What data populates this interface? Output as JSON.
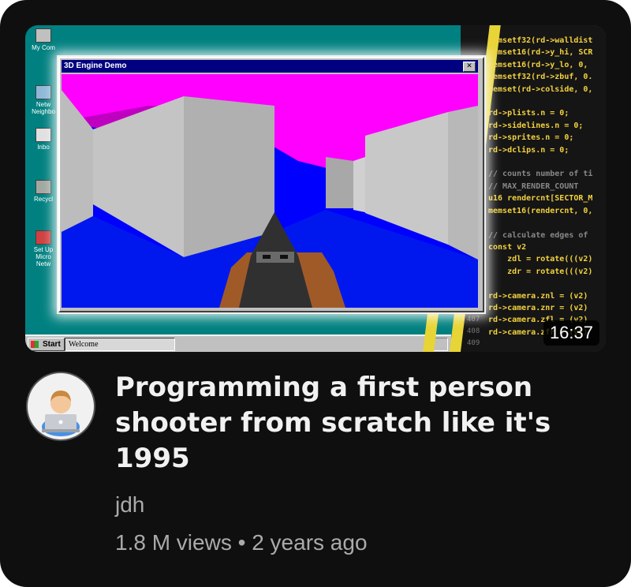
{
  "video": {
    "title": "Programming a first person shooter from scratch like it's 1995",
    "channel": "jdh",
    "views": "1.8 M views",
    "separator": "•",
    "age": "2 years ago",
    "duration": "16:37",
    "avatar_icon": "technologist-with-laptop-icon"
  },
  "thumbnail": {
    "window_title": "3D Engine Demo",
    "close_glyph": "✕",
    "desktop_icons": [
      "My Com",
      "Netw Neighbo",
      "Inbo",
      "Recycl",
      "Set Up Micro Netw"
    ],
    "taskbar": {
      "start_label": "Start",
      "task_label": "Welcome"
    },
    "code_lines": [
      "memsetf32(rd->walldist",
      "memset16(rd->y_hi, SCR",
      "memset16(rd->y_lo, 0,",
      "memsetf32(rd->zbuf, 0.",
      "memset(rd->colside, 0,",
      "",
      "rd->plists.n = 0;",
      "rd->sidelines.n = 0;",
      "rd->sprites.n = 0;",
      "rd->dclips.n = 0;",
      "",
      "// counts number of ti",
      "// MAX_RENDER_COUNT",
      "u16 rendercnt[SECTOR_M",
      "memset16(rendercnt, 0,",
      "",
      "// calculate edges of",
      "const v2",
      "    zdl = rotate(((v2)",
      "    zdr = rotate(((v2)",
      "",
      "rd->camera.znl = (v2)",
      "rd->camera.znr = (v2)",
      "rd->camera.zfl = (v2)",
      "rd->camera.zfr = (v2)"
    ],
    "line_numbers": [
      "407",
      "408",
      "409"
    ],
    "colors": {
      "ceiling": "#ff00ff",
      "floor": "#0000ff",
      "walls": "#c0c0c0",
      "desktop": "#008080",
      "titlebar": "#000080",
      "code_text": "#f2d13f",
      "stripe": "#e7d436"
    }
  }
}
